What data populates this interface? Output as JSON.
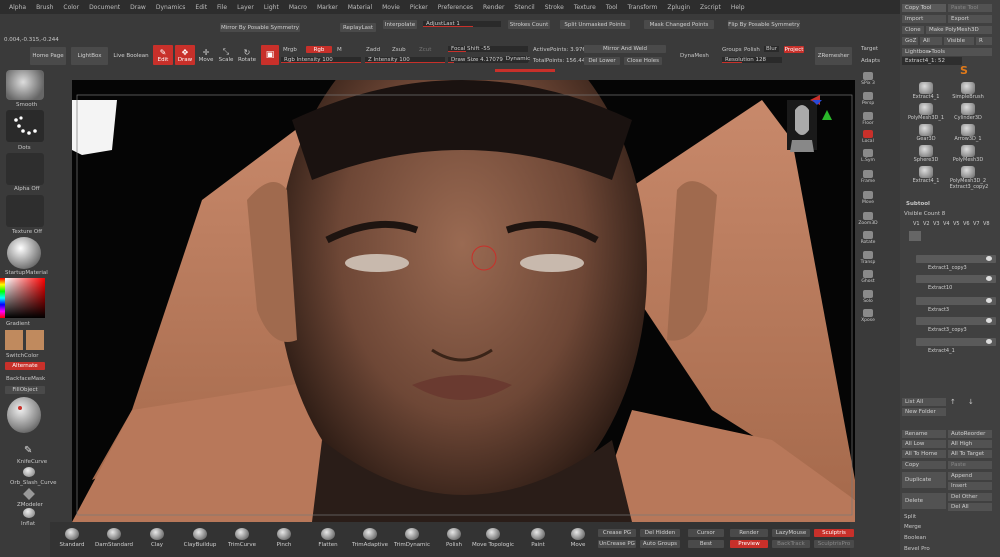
{
  "menu": [
    "Alpha",
    "Brush",
    "Color",
    "Document",
    "Draw",
    "Dynamics",
    "Edit",
    "File",
    "Layer",
    "Light",
    "Macro",
    "Marker",
    "Material",
    "Movie",
    "Picker",
    "Preferences",
    "Render",
    "Stencil",
    "Stroke",
    "Texture",
    "Tool",
    "Transform",
    "Zplugin",
    "Zscript",
    "Help"
  ],
  "row1": {
    "mirror_poseable": "Mirror By Posable Symmetry",
    "replay_last": "ReplayLast",
    "interpolate": "Interpolate",
    "adjust_last": "AdjustLast 1",
    "strokes_count": "Strokes Count",
    "split_unmasked": "Split Unmasked Points",
    "mask_changed": "Mask Changed Points",
    "flip_poseable": "Flip By Posable Symmetry"
  },
  "coords": "0.004,-0.315,-0.244",
  "toolbar": {
    "home_page": "Home Page",
    "lightbox": "LightBox",
    "live_boolean": "Live Boolean",
    "edit": "Edit",
    "draw": "Draw",
    "move": "Move",
    "scale": "Scale",
    "rotate": "Rotate",
    "mrgb": "Mrgb",
    "rgb": "Rgb",
    "m": "M",
    "zadd": "Zadd",
    "zsub": "Zsub",
    "zcut": "Zcut",
    "rgb_intensity": "Rgb Intensity 100",
    "z_intensity": "Z Intensity 100",
    "focal_shift": "Focal Shift -55",
    "draw_size": "Draw Size 4.17079",
    "dynamic": "Dynamic",
    "active_points": "ActivePoints: 3.976",
    "total_points": "TotalPoints: 156.446",
    "mirror_weld": "Mirror And Weld",
    "del_lower": "Del Lower",
    "close_holes": "Close Holes",
    "dynamesh": "DynaMesh",
    "groups": "Groups",
    "polish": "Polish",
    "blur": "Blur",
    "project": "Project",
    "resolution": "Resolution 128",
    "zremesher": "ZRemesher"
  },
  "left_shelf": {
    "smooth": "Smooth",
    "dots": "Dots",
    "alpha_off": "Alpha Off",
    "texture_off": "Texture Off",
    "startup_material": "StartupMaterial",
    "gradient": "Gradient",
    "switch_color": "SwitchColor",
    "alternate": "Alternate",
    "backface_mask": "BackfaceMask",
    "fill_object": "FillObject",
    "knife_curve": "KnifeCurve",
    "orb_slash_curve": "Orb_Slash_Curve",
    "zmodeler": "ZModeler",
    "inflat": "Inflat"
  },
  "view_icons": [
    "SPix 3",
    "Persp",
    "Floor",
    "Local",
    "L.Sym",
    "Frame",
    "Move",
    "Zoom3D",
    "Rotate",
    "Transp",
    "Ghost",
    "Solo",
    "Xpose"
  ],
  "brushes": [
    "Standard",
    "DamStandard",
    "Clay",
    "ClayBuildup",
    "TrimCurve",
    "Pinch",
    "Flatten",
    "TrimAdaptive",
    "TrimDynamic",
    "Polish",
    "Move Topologic",
    "Paint",
    "Move"
  ],
  "bottom": {
    "crease_pg": "Crease PG",
    "uncrease_pg": "UnCrease PG",
    "del_hidden": "Del Hidden",
    "auto_groups": "Auto Groups",
    "cursor": "Cursor",
    "best": "Best",
    "render": "Render",
    "preview": "Preview",
    "lazymouse": "LazyMouse",
    "backface": "BackTrack",
    "sculptris": "Sculptris",
    "sculptris_pro": "SculptrisPro"
  },
  "right": {
    "copy_tool": "Copy Tool",
    "paste_tool": "Paste Tool",
    "import": "Import",
    "export": "Export",
    "clone": "Clone",
    "make_polymesh": "Make PolyMesh3D",
    "goz": "GoZ",
    "all": "All",
    "visible": "Visible",
    "r": "R",
    "lightbox_tools": "Lightbox▸Tools",
    "extract_label": "Extract4_1: 52",
    "extract_count": "52",
    "tools": [
      {
        "name": "Extract4_1",
        "n": ""
      },
      {
        "name": "SimpleBrush",
        "n": ""
      },
      {
        "name": "PolyMesh3D_1",
        "n": ""
      },
      {
        "name": "Cylinder3D",
        "n": ""
      },
      {
        "name": "Gear3D",
        "n": ""
      },
      {
        "name": "Arrow3D_1",
        "n": ""
      },
      {
        "name": "Sphere3D",
        "n": ""
      },
      {
        "name": "PolyMesh3D",
        "n": ""
      },
      {
        "name": "Extract4_1",
        "n": "26"
      },
      {
        "name": "PolyMesh3D_2",
        "n": ""
      },
      {
        "name": "Extract3_copy2",
        "n": ""
      }
    ],
    "subtool": "Subtool",
    "visible_count": "Visible Count 8",
    "v_tabs": [
      "V1",
      "V2",
      "V3",
      "V4",
      "V5",
      "V6",
      "V7",
      "V8"
    ],
    "subtools": [
      "Extract1_copy3",
      "Extract10",
      "Extract3",
      "Extract3_copy3",
      "Extract4_1"
    ],
    "list_all": "List All",
    "new_folder": "New Folder",
    "rename": "Rename",
    "auto_reorder": "AutoReorder",
    "all_low": "All Low",
    "all_high": "All High",
    "all_to_home": "All To Home",
    "all_to_target": "All To Target",
    "copy": "Copy",
    "paste": "Paste",
    "duplicate": "Duplicate",
    "append": "Append",
    "insert": "Insert",
    "delete": "Delete",
    "del_other": "Del Other",
    "del_all": "Del All",
    "split": "Split",
    "merge": "Merge",
    "boolean": "Boolean",
    "bevel_pro": "Bevel Pro",
    "target": "Target",
    "adapts": "Adapts"
  },
  "colors": {
    "accent": "#c8302a",
    "panel": "#404040",
    "viewport": "#050505",
    "skin": "#b8785a"
  }
}
